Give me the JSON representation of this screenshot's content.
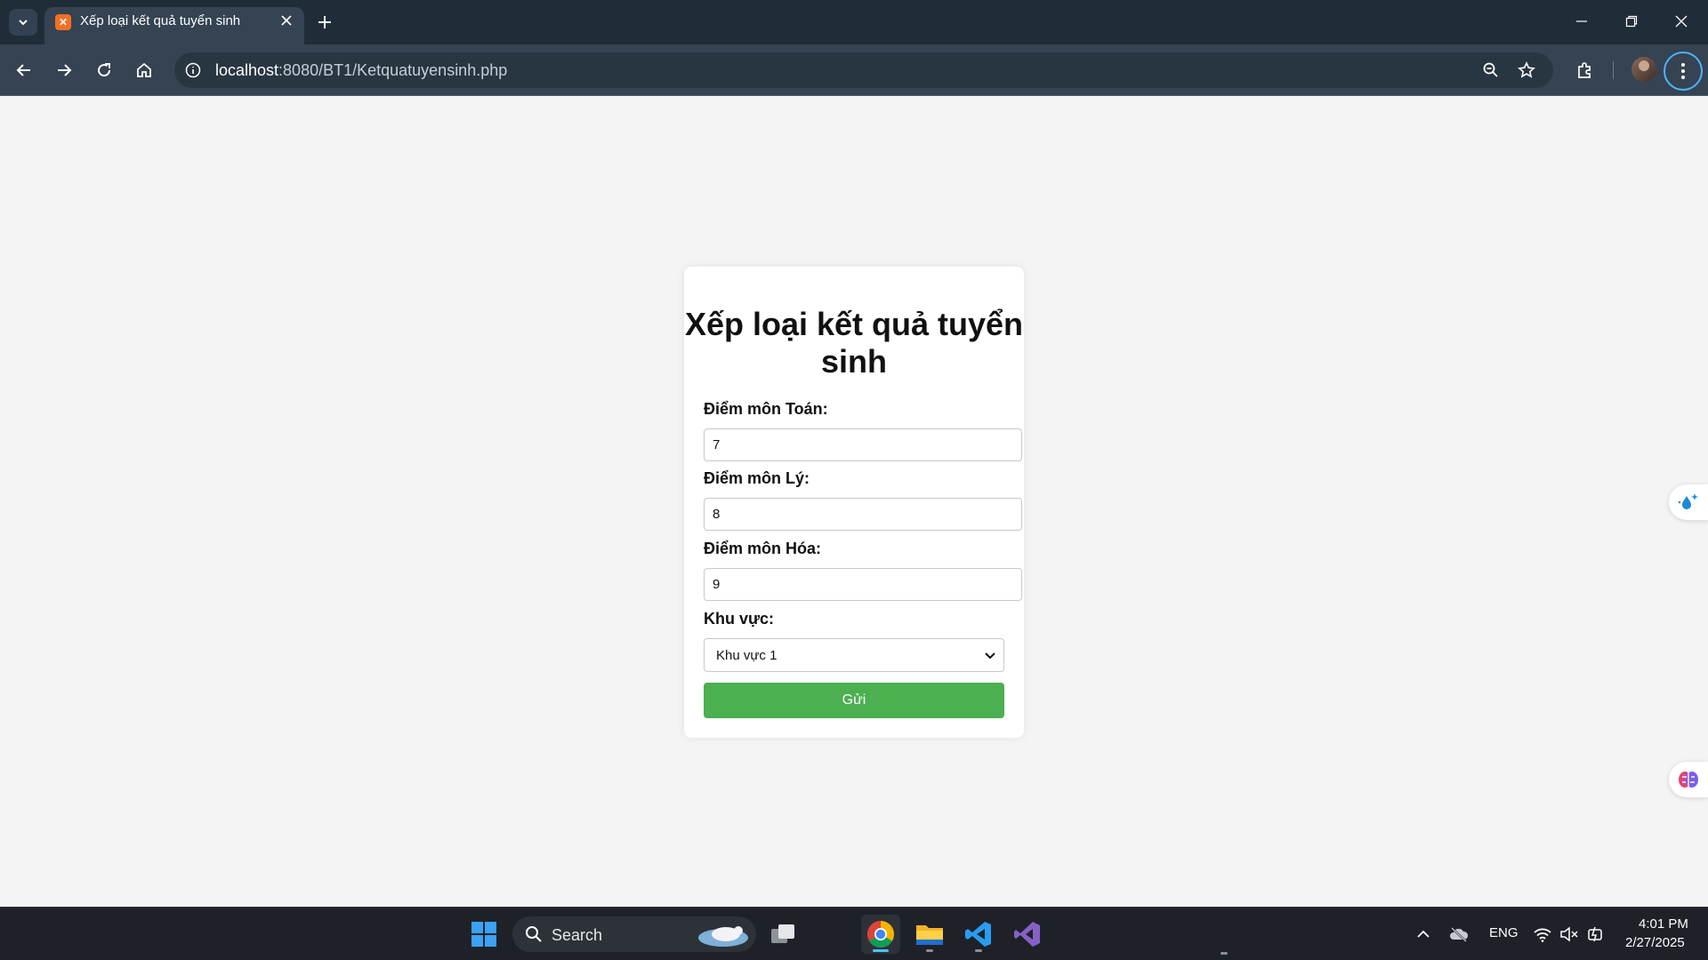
{
  "browser": {
    "tab_title": "Xếp loại kết quả tuyển sinh",
    "url_host": "localhost",
    "url_path": ":8080/BT1/Ketquatuyensinh.php"
  },
  "page": {
    "title": "Xếp loại kết quả tuyển sinh",
    "fields": [
      {
        "label": "Điểm môn Toán:",
        "value": "7"
      },
      {
        "label": "Điểm môn Lý:",
        "value": "8"
      },
      {
        "label": "Điểm môn Hóa:",
        "value": "9"
      }
    ],
    "region_label": "Khu vực:",
    "region_selected": "Khu vực 1",
    "submit_label": "Gửi"
  },
  "taskbar": {
    "search_label": "Search",
    "language": "ENG",
    "time": "4:01 PM",
    "date": "2/27/2025"
  },
  "colors": {
    "submit_button": "#4caf50",
    "page_background": "#f4f4f4",
    "tab_strip": "#202d38",
    "toolbar": "#354353"
  },
  "icons": [
    "tab-search-icon",
    "xampp-favicon-icon",
    "close-icon",
    "plus-icon",
    "minimize-icon",
    "restore-icon",
    "back-arrow-icon",
    "forward-arrow-icon",
    "reload-icon",
    "home-icon",
    "site-info-icon",
    "zoom-icon",
    "star-icon",
    "extensions-icon",
    "kebab-menu-icon",
    "chevron-down-icon",
    "windows-start-icon",
    "search-icon",
    "task-view-icon",
    "chrome-icon",
    "file-explorer-icon",
    "vscode-icon",
    "visual-studio-icon",
    "wifi-icon",
    "volume-muted-icon"
  ]
}
